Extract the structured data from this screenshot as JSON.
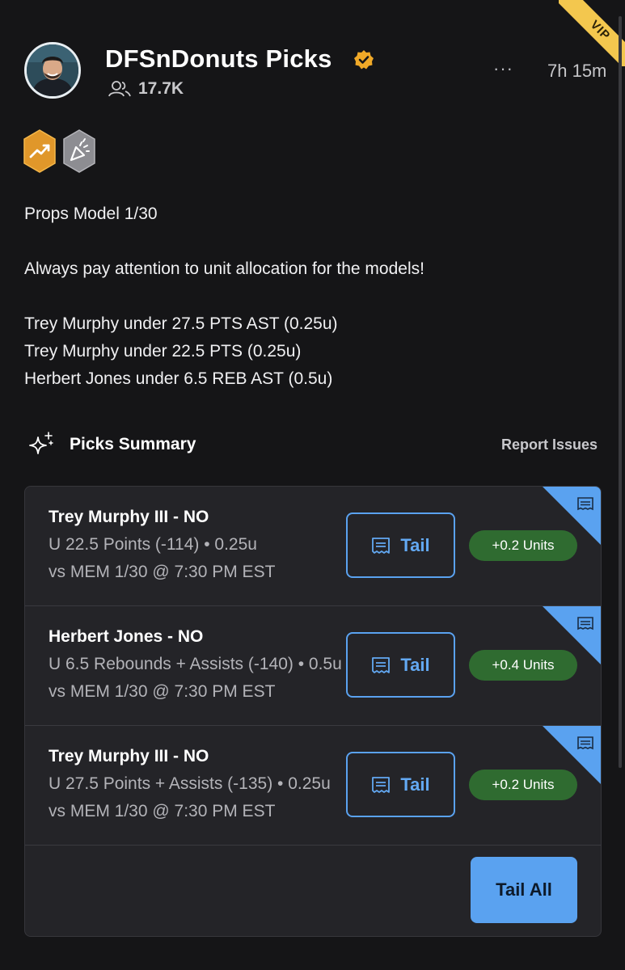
{
  "header": {
    "vip_label": "VIP",
    "title": "DFSnDonuts Picks",
    "followers": "17.7K",
    "more_label": "···",
    "time_ago": "7h 15m",
    "badges": [
      "trending-up-badge",
      "party-popper-badge"
    ]
  },
  "post": {
    "text": "Props Model 1/30\n\nAlways pay attention to unit allocation for the models!\n\nTrey Murphy under 27.5 PTS AST (0.25u)\nTrey Murphy under 22.5 PTS (0.25u)\nHerbert Jones under 6.5 REB AST (0.5u)"
  },
  "summary": {
    "title": "Picks Summary",
    "report_label": "Report Issues"
  },
  "picks": [
    {
      "title": "Trey Murphy III - NO",
      "line1": "U 22.5 Points (-114)  • 0.25u",
      "line2": "vs MEM 1/30 @ 7:30 PM EST",
      "tail_label": "Tail",
      "units": "+0.2 Units"
    },
    {
      "title": "Herbert Jones - NO",
      "line1": "U 6.5 Rebounds + Assists (-140)  • 0.5u",
      "line2": "vs MEM 1/30 @ 7:30 PM EST",
      "tail_label": "Tail",
      "units": "+0.4 Units"
    },
    {
      "title": "Trey Murphy III - NO",
      "line1": "U 27.5 Points + Assists (-135)  • 0.25u",
      "line2": "vs MEM 1/30 @ 7:30 PM EST",
      "tail_label": "Tail",
      "units": "+0.2 Units"
    }
  ],
  "tail_all_label": "Tail All",
  "colors": {
    "background": "#151517",
    "card": "#242428",
    "accent_blue": "#5aa2f0",
    "units_green": "#2f6b30",
    "vip_gold": "#f3c74e",
    "verified_gold": "#f0a928"
  }
}
